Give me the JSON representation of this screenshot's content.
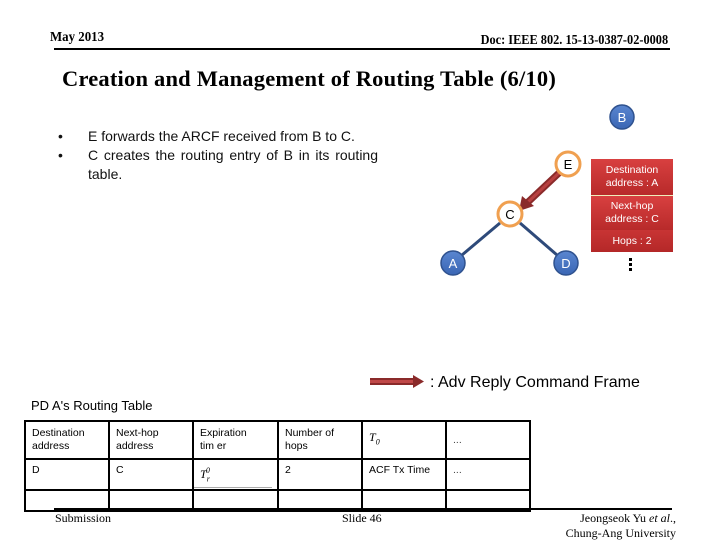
{
  "header": {
    "date": "May 2013",
    "doc_id": "Doc: IEEE 802. 15-13-0387-02-0008"
  },
  "title": "Creation and Management of Routing Table (6/10)",
  "bullets": [
    "E forwards the ARCF received from B to C.",
    "C creates the routing entry of B in its routing table."
  ],
  "diagram": {
    "nodes": [
      {
        "id": "B",
        "label": "B",
        "style": "blue"
      },
      {
        "id": "E",
        "label": "E",
        "style": "highlighted"
      },
      {
        "id": "C",
        "label": "C",
        "style": "highlighted"
      },
      {
        "id": "A",
        "label": "A",
        "style": "blue"
      },
      {
        "id": "D",
        "label": "D",
        "style": "blue"
      }
    ],
    "links": [
      [
        "C",
        "A"
      ],
      [
        "C",
        "D"
      ]
    ],
    "frame_arrow": {
      "from": "E",
      "to": "C"
    },
    "colors": {
      "node_blue": "#4472c4",
      "node_blue_stroke": "#2f528f",
      "highlight_stroke": "#f0a050",
      "link": "#2e4a7a",
      "arrow": "#a83232",
      "info_box": "#c83232"
    },
    "info_box": {
      "destination": [
        "Destination",
        "address : A"
      ],
      "next_hop": [
        "Next-hop",
        "address : C"
      ],
      "hops": "Hops : 2",
      "continuation": "⋮"
    }
  },
  "legend": {
    "label": ": Adv Reply Command Frame"
  },
  "routing_table": {
    "title": "PD A's Routing Table",
    "headers": [
      "Destination address",
      "Next-hop address",
      "Expiration timer",
      "Number of hops",
      "T0",
      "..."
    ],
    "header_lines": [
      [
        "Destination",
        "address"
      ],
      [
        "Next-hop",
        "address"
      ],
      [
        "Expiration",
        "tim er"
      ],
      [
        "Number of",
        "hops"
      ]
    ],
    "header_t0": {
      "base": "T",
      "sub": "0"
    },
    "header_more": "...",
    "rows": [
      {
        "dest": "D",
        "next_hop": "C",
        "timer": {
          "base": "T",
          "sub": "r",
          "sup": "0"
        },
        "hops": "2",
        "t0": "ACF Tx Time",
        "more": "..."
      },
      {
        "dest": "",
        "next_hop": "",
        "timer": null,
        "hops": "",
        "t0": "",
        "more": ""
      }
    ]
  },
  "footer": {
    "left": "Submission",
    "center": "Slide 46",
    "author_name": "Jeongseok Yu ",
    "author_etal": "et al",
    "author_suffix": ".,",
    "affiliation": "Chung-Ang University"
  }
}
